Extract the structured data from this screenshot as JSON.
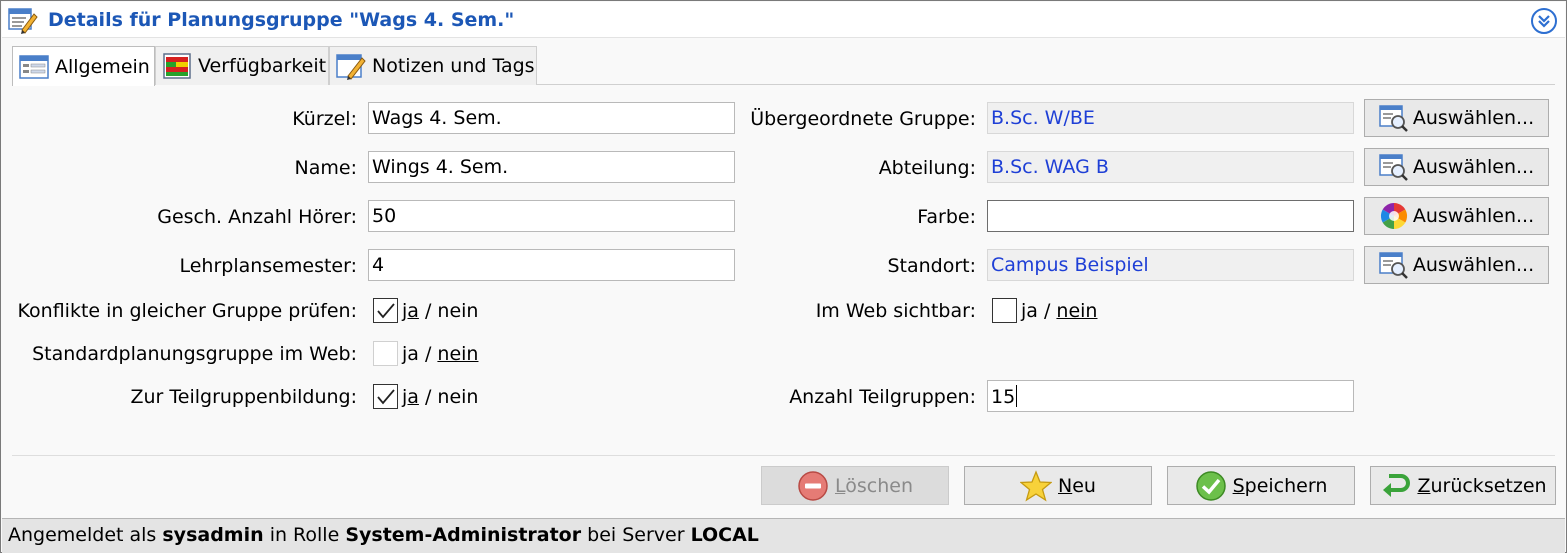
{
  "window": {
    "title": "Details für Planungsgruppe \"Wags 4. Sem.\""
  },
  "tabs": [
    {
      "label": "Allgemein",
      "icon": "form-icon",
      "active": true
    },
    {
      "label": "Verfügbarkeit",
      "icon": "availability-grid-icon",
      "active": false
    },
    {
      "label": "Notizen und Tags",
      "icon": "notes-edit-icon",
      "active": false
    }
  ],
  "form": {
    "kuerzel": {
      "label": "Kürzel:",
      "value": "Wags 4. Sem."
    },
    "name": {
      "label": "Name:",
      "value": "Wings 4. Sem."
    },
    "anzahl_hoerer": {
      "label": "Gesch. Anzahl Hörer:",
      "value": "50"
    },
    "lehrplansemester": {
      "label": "Lehrplansemester:",
      "value": "4"
    },
    "konflikte": {
      "label": "Konflikte in gleicher Gruppe prüfen:",
      "checked": true,
      "ja": "ja",
      "sep": "/",
      "nein": "nein"
    },
    "standardplanung": {
      "label": "Standardplanungsgruppe im Web:",
      "checked": false,
      "ja": "ja",
      "sep": "/",
      "nein": "nein"
    },
    "teilgruppen": {
      "label": "Zur Teilgruppenbildung:",
      "checked": true,
      "ja": "ja",
      "sep": "/",
      "nein": "nein"
    },
    "uebergeordnete_gruppe": {
      "label": "Übergeordnete Gruppe:",
      "value": "B.Sc. W/BE",
      "button": "Auswählen..."
    },
    "abteilung": {
      "label": "Abteilung:",
      "value": "B.Sc. WAG B",
      "button": "Auswählen..."
    },
    "farbe": {
      "label": "Farbe:",
      "value": "",
      "button": "Auswählen..."
    },
    "standort": {
      "label": "Standort:",
      "value": "Campus Beispiel",
      "button": "Auswählen..."
    },
    "web_sichtbar": {
      "label": "Im Web sichtbar:",
      "checked": false,
      "ja": "ja",
      "sep": "/",
      "nein": "nein"
    },
    "anzahl_teilgruppen": {
      "label": "Anzahl Teilgruppen:",
      "value": "15"
    }
  },
  "actions": {
    "loeschen": "Löschen",
    "neu": "Neu",
    "speichern": "Speichern",
    "zuruecksetzen": "Zurücksetzen"
  },
  "status": {
    "prefix": "Angemeldet als",
    "user": "sysadmin",
    "mid1": "in Rolle",
    "role": "System-Administrator",
    "mid2": "bei Server",
    "server": "LOCAL"
  },
  "colors": {
    "title": "#1c57b6",
    "link_value": "#1e3fd6"
  }
}
